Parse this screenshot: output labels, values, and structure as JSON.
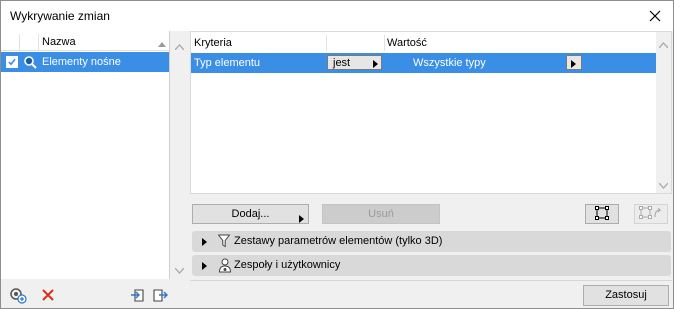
{
  "window": {
    "title": "Wykrywanie zmian"
  },
  "left_list": {
    "header": {
      "name": "Nazwa"
    },
    "items": [
      {
        "label": "Elementy nośne",
        "checked": true,
        "icon": "search-icon"
      }
    ]
  },
  "criteria_table": {
    "headers": {
      "criteria": "Kryteria",
      "value": "Wartość"
    },
    "rows": [
      {
        "criteria": "Typ elementu",
        "operator": "jest",
        "value": "Wszystkie typy"
      }
    ]
  },
  "buttons": {
    "add": "Dodaj...",
    "remove": "Usuń",
    "apply": "Zastosuj"
  },
  "sections": [
    {
      "label": "Zestawy parametrów elementów (tylko 3D)",
      "icon": "filter-icon"
    },
    {
      "label": "Zespoły i użytkownicy",
      "icon": "users-icon"
    }
  ],
  "colors": {
    "selection": "#3a8ee6",
    "delete": "#d9301e",
    "section_bg": "#d9d9d9"
  }
}
